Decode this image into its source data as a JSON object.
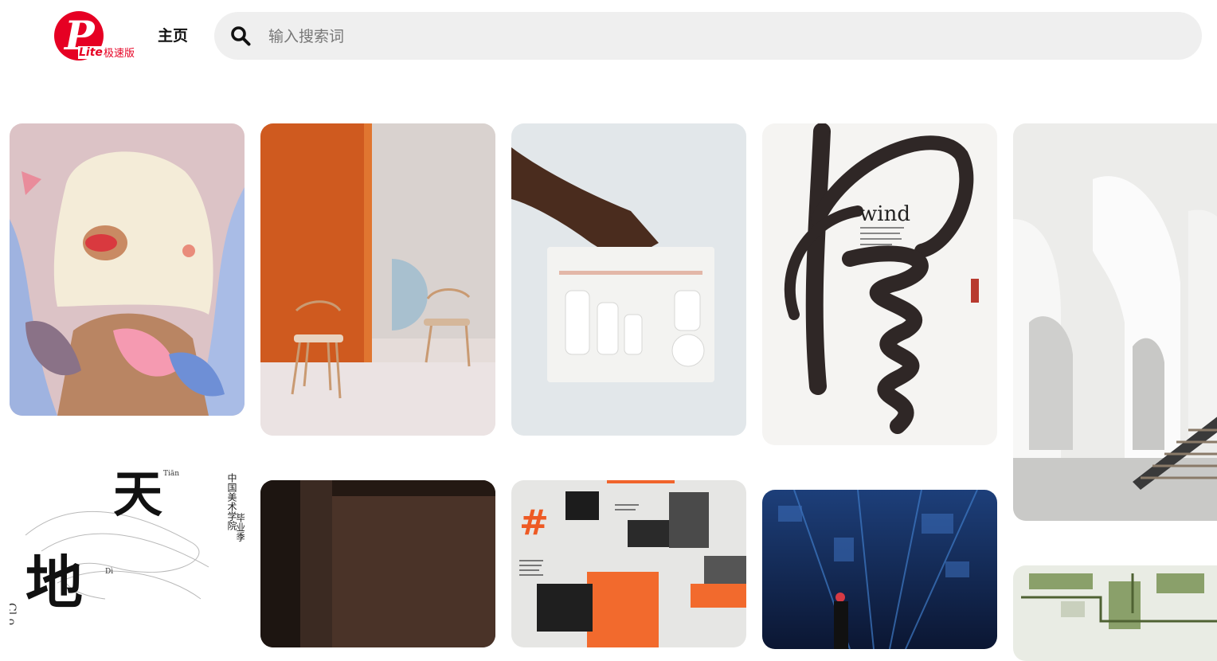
{
  "header": {
    "logo": {
      "letter": "P",
      "lite": "Lite",
      "subtitle": "极速版"
    },
    "home_label": "主页",
    "search": {
      "placeholder": "输入搜索词",
      "value": ""
    }
  },
  "pins": {
    "p1": {
      "subject": "woman-with-flowers-illustration"
    },
    "p2": {
      "subject": "orange-wall-wooden-chairs"
    },
    "p3": {
      "subject": "hand-holding-white-packaging"
    },
    "p4": {
      "title": "wind"
    },
    "p5": {
      "subject": "white-arched-architecture"
    },
    "p6": {
      "glyph1": "天",
      "glyph2": "地",
      "pinyin1": "Tiān",
      "pinyin2": "Dì",
      "vertical1": "中国美术学院",
      "vertical2": "毕业季",
      "side_text": "Cl o"
    },
    "p7": {
      "subject": "dark-interior"
    },
    "p8": {
      "hash": "#",
      "subject": "sport-magazine-layout"
    },
    "p9": {
      "subject": "night-city-poster"
    },
    "p10": {
      "subject": "aerial-garden-plan"
    }
  },
  "colors": {
    "brand": "#e60023",
    "search_bg": "#efefef"
  }
}
